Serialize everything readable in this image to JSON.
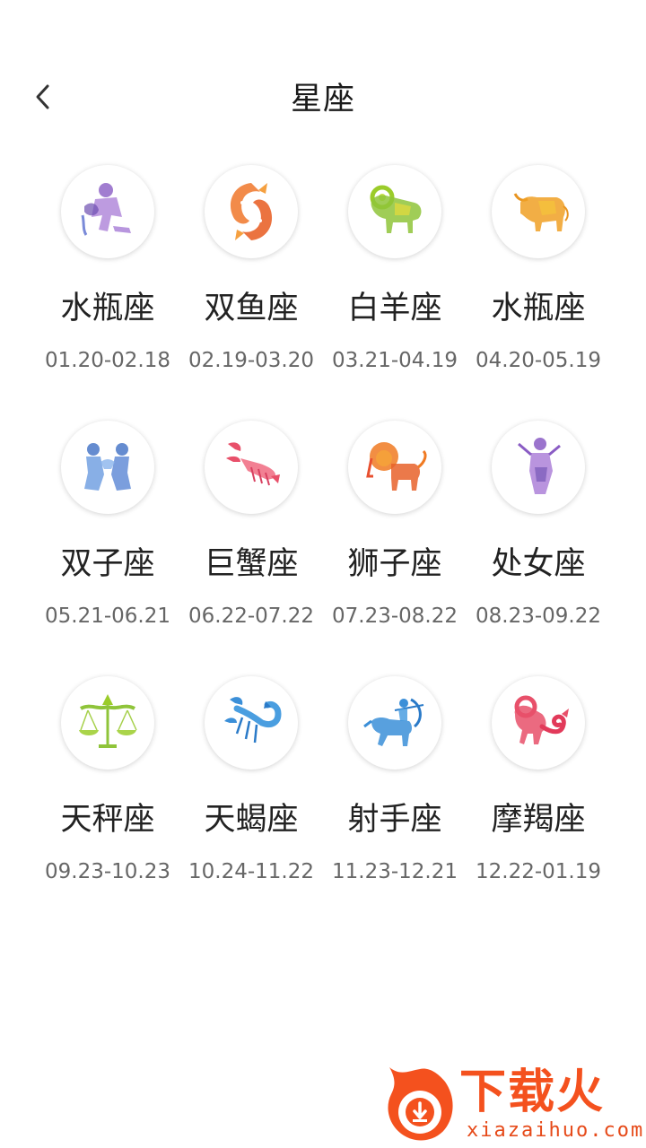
{
  "header": {
    "title": "星座",
    "back_icon": "chevron-left-icon"
  },
  "signs": [
    {
      "name": "水瓶座",
      "date": "01.20-02.18",
      "icon": "aquarius-icon",
      "color": "#8a5cc4"
    },
    {
      "name": "双鱼座",
      "date": "02.19-03.20",
      "icon": "pisces-icon",
      "color": "#f0772a"
    },
    {
      "name": "白羊座",
      "date": "03.21-04.19",
      "icon": "aries-icon",
      "color": "#9bcc2a"
    },
    {
      "name": "水瓶座",
      "date": "04.20-05.19",
      "icon": "taurus-icon",
      "color": "#f0a024"
    },
    {
      "name": "双子座",
      "date": "05.21-06.21",
      "icon": "gemini-icon",
      "color": "#4a78c8"
    },
    {
      "name": "巨蟹座",
      "date": "06.22-07.22",
      "icon": "cancer-icon",
      "color": "#e8506a"
    },
    {
      "name": "狮子座",
      "date": "07.23-08.22",
      "icon": "leo-icon",
      "color": "#f07a22"
    },
    {
      "name": "处女座",
      "date": "08.23-09.22",
      "icon": "virgo-icon",
      "color": "#8a5cc4"
    },
    {
      "name": "天秤座",
      "date": "09.23-10.23",
      "icon": "libra-icon",
      "color": "#9bcc2a"
    },
    {
      "name": "天蝎座",
      "date": "10.24-11.22",
      "icon": "scorpio-icon",
      "color": "#3b8fd8"
    },
    {
      "name": "射手座",
      "date": "11.23-12.21",
      "icon": "sagittarius-icon",
      "color": "#3b8fd8"
    },
    {
      "name": "摩羯座",
      "date": "12.22-01.19",
      "icon": "capricorn-icon",
      "color": "#e8506a"
    }
  ],
  "watermark": {
    "text": "下载火",
    "url": "xiazaihuo.com",
    "color": "#f4511e"
  }
}
